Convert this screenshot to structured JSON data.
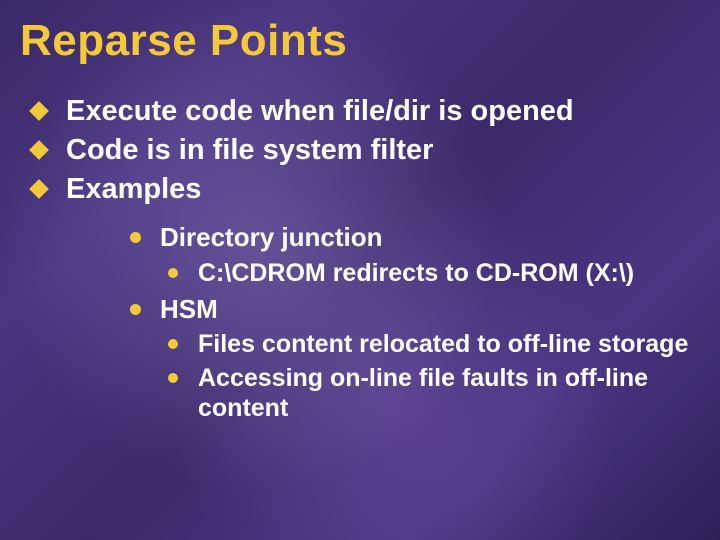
{
  "title": "Reparse Points",
  "bullets": {
    "b0": "Execute code when file/dir is opened",
    "b1": "Code is in file system filter",
    "b2": "Examples"
  },
  "sub1": {
    "s0": "Directory junction",
    "s1": "HSM"
  },
  "sub2": {
    "dj0": "C:\\CDROM redirects to CD-ROM (X:\\)",
    "hsm0": "Files content relocated to off‑line storage",
    "hsm1": "Accessing on‑line file faults in off‑line content"
  },
  "colors": {
    "accent": "#f3c93a",
    "text": "#ffffff"
  }
}
